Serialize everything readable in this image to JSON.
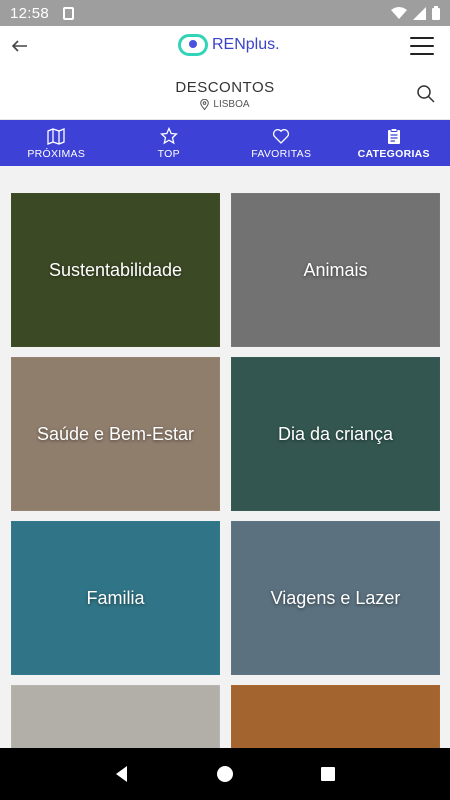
{
  "status": {
    "time": "12:58"
  },
  "header": {
    "logo_text": "RENplus."
  },
  "subheader": {
    "title": "DESCONTOS",
    "location": "LISBOA"
  },
  "tabs": [
    {
      "label": "PRÓXIMAS",
      "icon": "map-icon"
    },
    {
      "label": "TOP",
      "icon": "star-icon"
    },
    {
      "label": "FAVORITAS",
      "icon": "heart-icon"
    },
    {
      "label": "CATEGORIAS",
      "icon": "clipboard-icon",
      "active": true
    }
  ],
  "categories": [
    {
      "label": "Sustentabilidade",
      "color": "#4a5a2e"
    },
    {
      "label": "Animais",
      "color": "#8c8c8c"
    },
    {
      "label": "Saúde e Bem-Estar",
      "color": "#b09a86"
    },
    {
      "label": "Dia da criança",
      "color": "#3f6b62"
    },
    {
      "label": "Familia",
      "color": "#3b8fa5"
    },
    {
      "label": "Viagens e Lazer",
      "color": "#6f8a9c"
    },
    {
      "label": "",
      "color": "#d9d6cf"
    },
    {
      "label": "",
      "color": "#c87a3a"
    }
  ],
  "colors": {
    "accent": "#3d41d6",
    "logo": "#3b43c7",
    "logo_mark": "#31d4b8"
  }
}
